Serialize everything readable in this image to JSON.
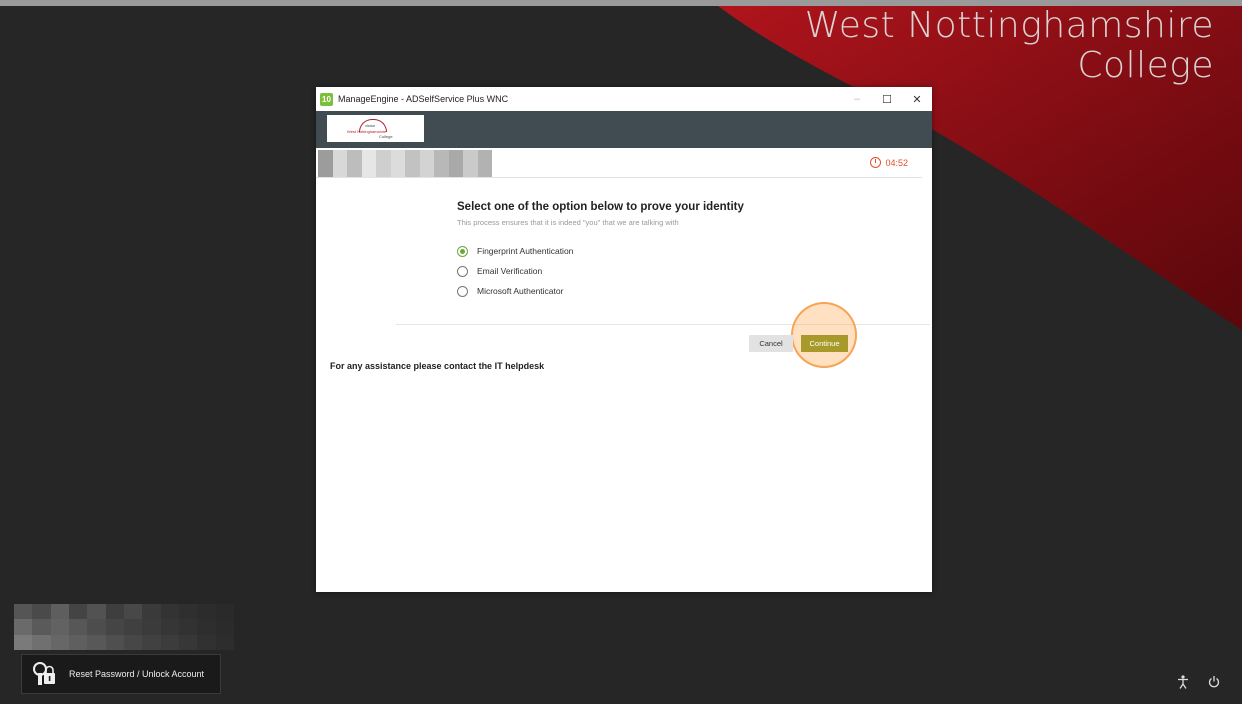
{
  "brand": {
    "line1": "West Nottinghamshire",
    "line2": "College"
  },
  "window": {
    "title": "ManageEngine - ADSelfService Plus WNC",
    "app_icon_text": "10",
    "controls": {
      "minimize": "–",
      "maximize": "☐",
      "close": "✕"
    }
  },
  "logo": {
    "line1": "vision",
    "line2": "West Nottinghamshire",
    "line3": "College"
  },
  "timer": {
    "value": "04:52"
  },
  "prompt": {
    "heading": "Select one of the option below to prove your identity",
    "subheading": "This process ensures that it is indeed \"you\" that we are talking with"
  },
  "options": [
    {
      "label": "Fingerprint Authentication",
      "selected": true
    },
    {
      "label": "Email Verification",
      "selected": false
    },
    {
      "label": "Microsoft Authenticator",
      "selected": false
    }
  ],
  "buttons": {
    "cancel": "Cancel",
    "continue": "Continue"
  },
  "assist_text": "For any assistance please contact the IT helpdesk",
  "lockscreen": {
    "reset_label": "Reset Password / Unlock Account",
    "accessibility_icon": "accessibility-icon",
    "power_icon": "power-icon"
  },
  "colors": {
    "accent_green": "#6aa63a",
    "continue_button": "#a89a2a",
    "timer": "#e0512b",
    "brand_red": "#8b0d14"
  }
}
